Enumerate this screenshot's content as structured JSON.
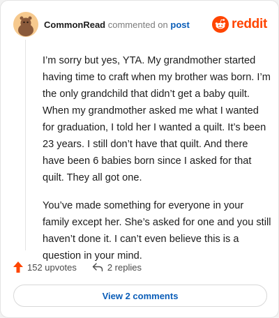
{
  "comment": {
    "username": "CommonRead",
    "action_text": "commented on",
    "post_link": "post",
    "paragraphs": [
      "I’m sorry but yes, YTA. My grandmother started having time to craft when my brother was born. I’m the only grandchild that didn’t get a baby quilt. When my grandmother asked me what I wanted for graduation, I told her I wanted a quilt. It’s been 23 years. I still don’t have that quilt. And there have been 6 babies born since I asked for that quilt. They all got one.",
      "You’ve made something for everyone in your family except her. She’s asked for one and you still haven’t done it. I can’t even believe this is a question in your mind."
    ],
    "upvotes": "152 upvotes",
    "replies": "2 replies",
    "view_comments": "View 2 comments"
  },
  "brand": {
    "name": "reddit",
    "color": "#ff4500"
  },
  "colors": {
    "link": "#0a5db8",
    "upvote": "#ff4500"
  },
  "icons": [
    "avatar",
    "reddit-logo-icon",
    "upvote-arrow-icon",
    "reply-arrow-icon"
  ]
}
